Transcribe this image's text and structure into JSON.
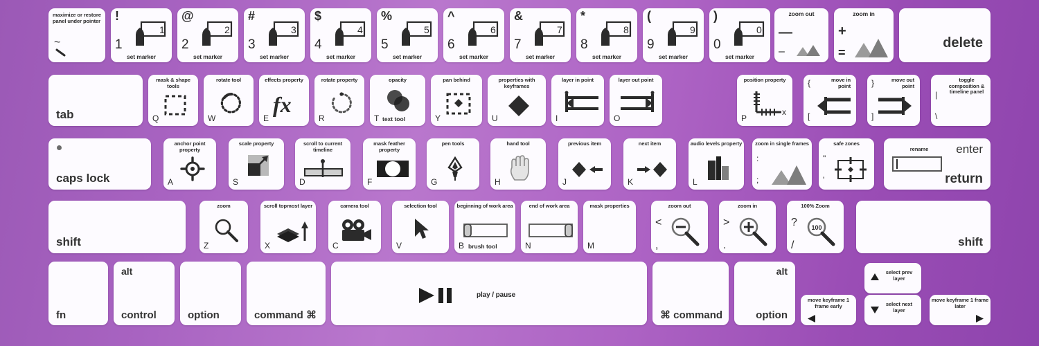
{
  "meta": {
    "title": "Adobe After Effects Keyboard Shortcuts Layout",
    "background_from": "#9b59b6",
    "background_to": "#8e44ad",
    "key_color": "#fdfbff",
    "ink_color": "#2b2b2b"
  },
  "rows": {
    "number_row": [
      {
        "name": "tilde",
        "caption": "maximize or restore panel under pointer",
        "legend": "~",
        "shift": "",
        "icon": "backslash-mark"
      },
      {
        "name": "1",
        "caption": "set marker",
        "legend": "1",
        "shift": "!",
        "icon": "marker-1"
      },
      {
        "name": "2",
        "caption": "set marker",
        "legend": "2",
        "shift": "@",
        "icon": "marker-2"
      },
      {
        "name": "3",
        "caption": "set marker",
        "legend": "3",
        "shift": "#",
        "icon": "marker-3"
      },
      {
        "name": "4",
        "caption": "set marker",
        "legend": "4",
        "shift": "$",
        "icon": "marker-4"
      },
      {
        "name": "5",
        "caption": "set marker",
        "legend": "5",
        "shift": "%",
        "icon": "marker-5"
      },
      {
        "name": "6",
        "caption": "set marker",
        "legend": "6",
        "shift": "^",
        "icon": "marker-6"
      },
      {
        "name": "7",
        "caption": "set marker",
        "legend": "7",
        "shift": "&",
        "icon": "marker-7"
      },
      {
        "name": "8",
        "caption": "set marker",
        "legend": "8",
        "shift": "*",
        "icon": "marker-8"
      },
      {
        "name": "9",
        "caption": "set marker",
        "legend": "9",
        "shift": "(",
        "icon": "marker-9"
      },
      {
        "name": "0",
        "caption": "set marker",
        "legend": "0",
        "shift": ")",
        "icon": "marker-0"
      },
      {
        "name": "minus",
        "caption": "zoom out",
        "legend": "–",
        "shift": "—",
        "icon": "mountains-small"
      },
      {
        "name": "equals",
        "caption": "zoom in",
        "legend": "=",
        "shift": "+",
        "icon": "mountains-large"
      },
      {
        "name": "delete",
        "caption": "",
        "legend": "",
        "word": "delete",
        "icon": ""
      }
    ],
    "tab_row": [
      {
        "name": "tab",
        "caption": "",
        "word": "tab",
        "legend": "",
        "icon": ""
      },
      {
        "name": "q",
        "caption": "mask & shape tools",
        "legend": "Q",
        "icon": "dashed-square"
      },
      {
        "name": "w",
        "caption": "rotate tool",
        "legend": "W",
        "icon": "rotate-solid"
      },
      {
        "name": "e",
        "caption": "effects property",
        "legend": "E",
        "icon": "fx"
      },
      {
        "name": "r",
        "caption": "rotate property",
        "legend": "R",
        "icon": "rotate-dotted"
      },
      {
        "name": "t",
        "caption": "opacity",
        "legend": "T",
        "sublabel": "text tool",
        "icon": "two-circles"
      },
      {
        "name": "y",
        "caption": "pan behind",
        "legend": "Y",
        "icon": "pan-behind"
      },
      {
        "name": "u",
        "caption": "properties with keyframes",
        "legend": "U",
        "icon": "diamond"
      },
      {
        "name": "i",
        "caption": "layer in point",
        "legend": "I",
        "icon": "in-point"
      },
      {
        "name": "o",
        "caption": "layer out point",
        "legend": "O",
        "icon": "out-point"
      },
      {
        "name": "p",
        "caption": "position property",
        "legend": "P",
        "icon": "position-axes"
      },
      {
        "name": "bracket-left",
        "caption": "move in point",
        "legend": "[",
        "shift": "{",
        "icon": "move-in-point"
      },
      {
        "name": "bracket-right",
        "caption": "move out point",
        "legend": "]",
        "shift": "}",
        "icon": "move-out-point"
      },
      {
        "name": "backslash",
        "caption": "toggle composition & timeline panel",
        "legend": "\\",
        "shift": "|",
        "icon": ""
      }
    ],
    "home_row": [
      {
        "name": "caps-lock",
        "caption": "",
        "word": "caps lock",
        "legend": "",
        "icon": "caps-led"
      },
      {
        "name": "a",
        "caption": "anchor point property",
        "legend": "A",
        "icon": "anchor-point"
      },
      {
        "name": "s",
        "caption": "scale property",
        "legend": "S",
        "icon": "scale"
      },
      {
        "name": "d",
        "caption": "scroll to current timeline",
        "legend": "D",
        "icon": "scroll-timeline"
      },
      {
        "name": "f",
        "caption": "mask feather property",
        "legend": "F",
        "icon": "mask-feather"
      },
      {
        "name": "g",
        "caption": "pen tools",
        "legend": "G",
        "icon": "pen-tool"
      },
      {
        "name": "h",
        "caption": "hand tool",
        "legend": "H",
        "icon": "hand-tool"
      },
      {
        "name": "j",
        "caption": "previous item",
        "legend": "J",
        "icon": "diamond-left-arrow"
      },
      {
        "name": "k",
        "caption": "next item",
        "legend": "K",
        "icon": "right-arrow-diamond"
      },
      {
        "name": "l",
        "caption": "audio levels property",
        "legend": "L",
        "icon": "audio-bars"
      },
      {
        "name": "semicolon",
        "caption": "zoom in single frames",
        "legend": ";",
        "shift": ":",
        "icon": "mountains-large"
      },
      {
        "name": "quote",
        "caption": "safe zones",
        "legend": "'",
        "shift": "\"",
        "icon": "safe-zones"
      },
      {
        "name": "return",
        "caption": "rename",
        "word": "return",
        "word_top": "enter",
        "legend": "",
        "icon": "rename-field"
      }
    ],
    "shift_row": [
      {
        "name": "shift-left",
        "caption": "",
        "word": "shift",
        "legend": "",
        "icon": ""
      },
      {
        "name": "z",
        "caption": "zoom",
        "legend": "Z",
        "icon": "magnifier"
      },
      {
        "name": "x",
        "caption": "scroll topmost layer",
        "legend": "X",
        "icon": "layer-arrow"
      },
      {
        "name": "c",
        "caption": "camera tool",
        "legend": "C",
        "icon": "camera"
      },
      {
        "name": "v",
        "caption": "selection tool",
        "legend": "V",
        "icon": "cursor-arrow"
      },
      {
        "name": "b",
        "caption": "beginning of work area",
        "legend": "B",
        "sublabel": "brush tool",
        "icon": "work-area-start"
      },
      {
        "name": "n",
        "caption": "end of work area",
        "legend": "N",
        "icon": "work-area-end"
      },
      {
        "name": "m",
        "caption": "mask properties",
        "legend": "M",
        "icon": ""
      },
      {
        "name": "comma",
        "caption": "zoom out",
        "legend": ",",
        "shift": "<",
        "icon": "magnifier-minus"
      },
      {
        "name": "period",
        "caption": "zoom in",
        "legend": ".",
        "shift": ">",
        "icon": "magnifier-plus"
      },
      {
        "name": "slash",
        "caption": "100% Zoom",
        "legend": "/",
        "shift": "?",
        "icon": "magnifier-100"
      },
      {
        "name": "shift-right",
        "caption": "",
        "word": "shift",
        "legend": "",
        "icon": ""
      }
    ],
    "bottom_row": [
      {
        "name": "fn",
        "caption": "",
        "word": "fn",
        "top_word": "",
        "icon": ""
      },
      {
        "name": "control",
        "caption": "",
        "word": "control",
        "top_word": "alt",
        "icon": ""
      },
      {
        "name": "option-left",
        "caption": "",
        "word": "option",
        "top_word": "",
        "icon": ""
      },
      {
        "name": "command-left",
        "caption": "",
        "word": "command ⌘",
        "top_word": "",
        "icon": ""
      },
      {
        "name": "space",
        "caption": "play / pause",
        "word": "",
        "icon": "play-pause"
      },
      {
        "name": "command-right",
        "caption": "",
        "word": "⌘ command",
        "top_word": "",
        "icon": ""
      },
      {
        "name": "option-right",
        "caption": "",
        "word": "option",
        "top_word": "alt",
        "icon": ""
      }
    ],
    "arrow_cluster": [
      {
        "name": "arrow-left",
        "caption": "move keyframe 1 frame early",
        "icon": "arrow-left"
      },
      {
        "name": "arrow-up",
        "caption": "select prev layer",
        "icon": "arrow-up"
      },
      {
        "name": "arrow-down",
        "caption": "select next layer",
        "icon": "arrow-down"
      },
      {
        "name": "arrow-right",
        "caption": "move keyframe 1 frame later",
        "icon": "arrow-right"
      }
    ]
  }
}
